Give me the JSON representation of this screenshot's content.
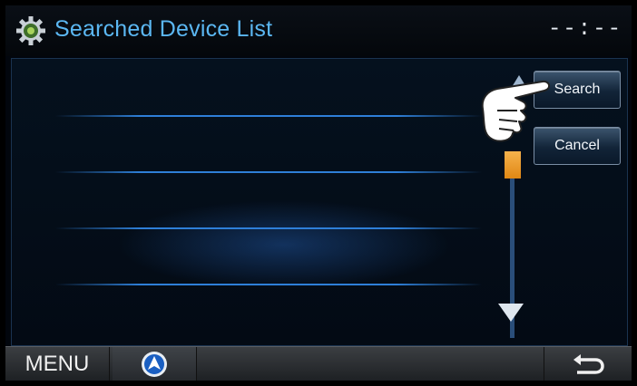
{
  "header": {
    "title": "Searched Device List",
    "clock": "--:--",
    "settings_icon": "gear-icon"
  },
  "device_list": {
    "rows": [
      "",
      "",
      "",
      ""
    ]
  },
  "side_buttons": {
    "search_label": "Search",
    "cancel_label": "Cancel"
  },
  "scrollbar": {
    "up_icon": "arrow-up-icon",
    "down_icon": "arrow-down-icon",
    "thumb_color": "#e8951f",
    "position": 0.0
  },
  "footer": {
    "menu_label": "MENU",
    "nav_icon": "navigation-icon",
    "back_icon": "back-icon"
  },
  "colors": {
    "title": "#5bb7f2",
    "accent": "#2e7fd8"
  }
}
